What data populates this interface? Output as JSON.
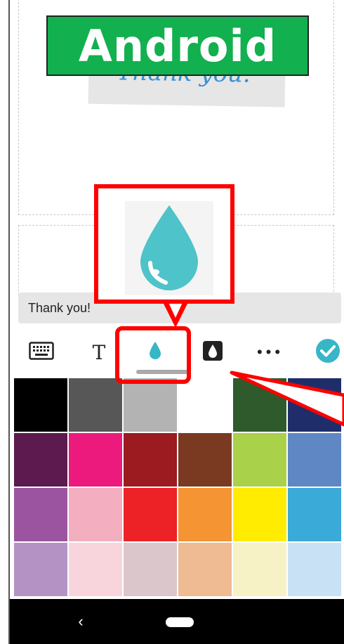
{
  "banner": {
    "label": "Android"
  },
  "sticker": {
    "text": "Thank you."
  },
  "text_input": {
    "value": "Thank you!"
  },
  "toolbar": {
    "tools": [
      {
        "name": "keyboard",
        "icon": "keyboard-icon"
      },
      {
        "name": "text",
        "icon": "text-format-icon",
        "glyph": "T"
      },
      {
        "name": "fill-color",
        "icon": "drop-icon",
        "selected": true
      },
      {
        "name": "outline-color",
        "icon": "drop-outline-icon"
      },
      {
        "name": "more",
        "icon": "more-icon",
        "glyph": "•••"
      },
      {
        "name": "done",
        "icon": "check-circle-icon"
      }
    ]
  },
  "palette": {
    "rows": [
      [
        "#000000",
        "#575757",
        "#b3b3b3",
        "#ffffff",
        "#2f5a2b",
        "#1f2e6b"
      ],
      [
        "#5c1a4e",
        "#ec1a7c",
        "#9b1b20",
        "#7a3a22",
        "#a9d14a",
        "#5f87c4"
      ],
      [
        "#9b55a0",
        "#f3afc0",
        "#ed2227",
        "#f49432",
        "#ffec00",
        "#3aaad9"
      ],
      [
        "#b493c4",
        "#f8d5dc",
        "#dbc6cb",
        "#eebb93",
        "#f7f2c6",
        "#c9e1f4"
      ]
    ]
  },
  "nav": {
    "back_glyph": "‹"
  },
  "colors": {
    "accent": "#36b6c6",
    "banner_bg": "#12b04f",
    "highlight": "#ff0000"
  }
}
